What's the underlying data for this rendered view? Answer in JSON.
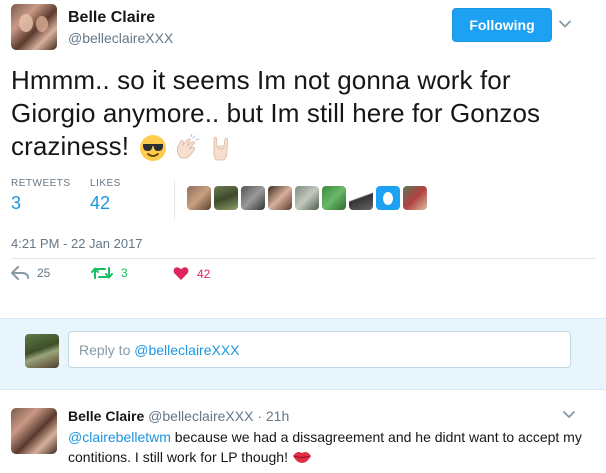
{
  "tweet": {
    "display_name": "Belle Claire",
    "screen_name": "@belleclaireXXX",
    "follow_label": "Following",
    "text": "Hmmm.. so it seems Im not gonna work for Giorgio anymore.. but Im still here for Gonzos craziness!",
    "emojis": [
      "sunglasses-face",
      "clapping-hands",
      "rock-on-hand"
    ],
    "timestamp": "4:21 PM - 22 Jan 2017"
  },
  "stats": {
    "retweets_label": "RETWEETS",
    "retweets_value": "3",
    "likes_label": "LIKES",
    "likes_value": "42",
    "liker_avatar_count": 9
  },
  "actions": {
    "reply_count": "25",
    "retweet_count": "3",
    "like_count": "42"
  },
  "colors": {
    "accent": "#1da1f2",
    "link": "#1b95e0",
    "muted": "#657786",
    "retweet": "#17bf63",
    "like": "#e0245e",
    "reply_bg": "#e8f5fd"
  },
  "reply_box": {
    "prefix": "Reply to ",
    "mention": "@belleclaireXXX"
  },
  "reply": {
    "display_name": "Belle Claire",
    "screen_name": "@belleclaireXXX",
    "dot": "·",
    "time": "21h",
    "mention": "@clairebelletwm",
    "text": " because we had a dissagreement and he didnt want to accept my contitions. I still work for LP though! ",
    "emoji": "lips"
  }
}
